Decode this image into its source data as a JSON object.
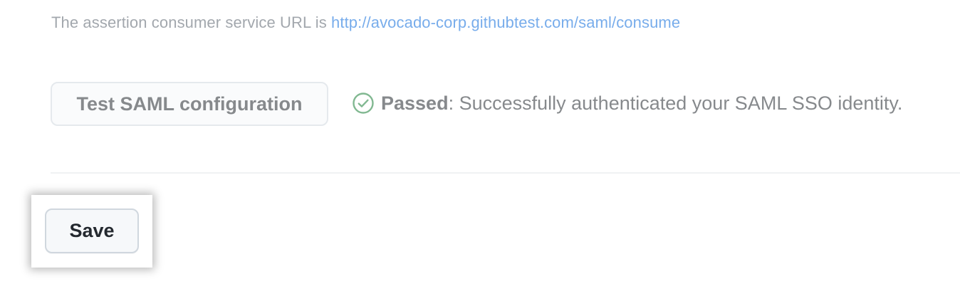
{
  "acs": {
    "prefix": "The assertion consumer service URL is ",
    "url": "http://avocado-corp.githubtest.com/saml/consume"
  },
  "test": {
    "button_label": "Test SAML configuration",
    "status_icon": "check-circle-icon",
    "status_label": "Passed",
    "status_separator": ":",
    "status_message": " Successfully authenticated your SAML SSO identity.",
    "status_color": "#1a7f37"
  },
  "form": {
    "save_label": "Save"
  },
  "colors": {
    "link": "#0969da",
    "button_bg": "#f6f8fa",
    "button_border": "#d0d7de"
  }
}
